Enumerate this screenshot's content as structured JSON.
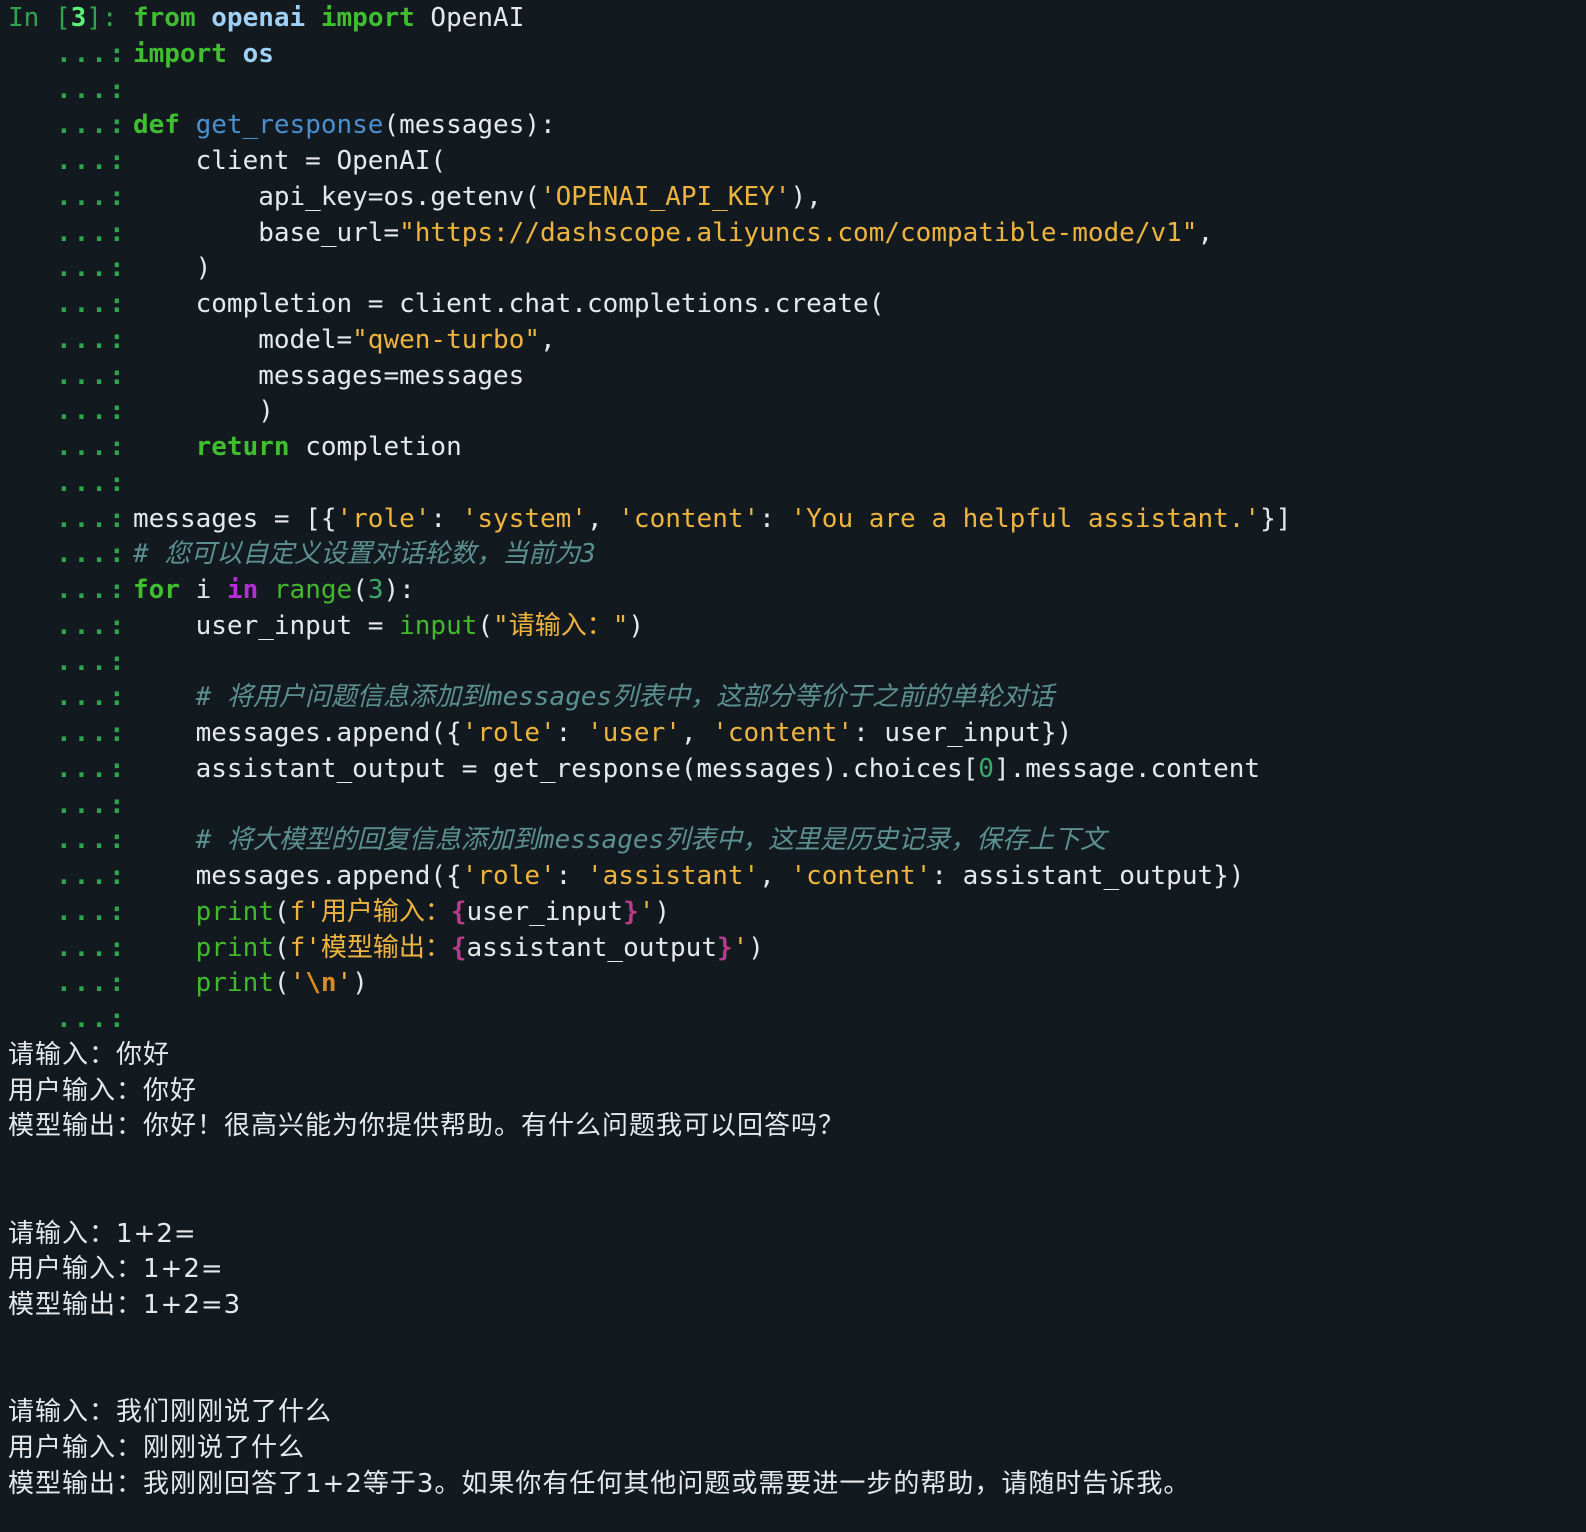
{
  "prompt": {
    "in_label": "In [",
    "cell_number": "3",
    "suffix": "]: "
  },
  "continuation_prompt": "...:",
  "code_lines": [
    [
      [
        "kw",
        "from"
      ],
      [
        "plain",
        " "
      ],
      [
        "mod",
        "openai"
      ],
      [
        "plain",
        " "
      ],
      [
        "kw",
        "import"
      ],
      [
        "plain",
        " OpenAI"
      ]
    ],
    [
      [
        "kw",
        "import"
      ],
      [
        "plain",
        " "
      ],
      [
        "mod",
        "os"
      ]
    ],
    [],
    [
      [
        "kw",
        "def"
      ],
      [
        "plain",
        " "
      ],
      [
        "fn",
        "get_response"
      ],
      [
        "plain",
        "(messages):"
      ]
    ],
    [
      [
        "plain",
        "    client = OpenAI("
      ]
    ],
    [
      [
        "plain",
        "        api_key=os.getenv("
      ],
      [
        "str",
        "'OPENAI_API_KEY'"
      ],
      [
        "plain",
        "),"
      ]
    ],
    [
      [
        "plain",
        "        base_url="
      ],
      [
        "str",
        "\"https://dashscope.aliyuncs.com/compatible-mode/v1\""
      ],
      [
        "plain",
        ","
      ]
    ],
    [
      [
        "plain",
        "    )"
      ]
    ],
    [
      [
        "plain",
        "    completion = client.chat.completions.create("
      ]
    ],
    [
      [
        "plain",
        "        model="
      ],
      [
        "str",
        "\"qwen-turbo\""
      ],
      [
        "plain",
        ","
      ]
    ],
    [
      [
        "plain",
        "        messages=messages"
      ]
    ],
    [
      [
        "plain",
        "        )"
      ]
    ],
    [
      [
        "plain",
        "    "
      ],
      [
        "kw",
        "return"
      ],
      [
        "plain",
        " completion"
      ]
    ],
    [],
    [
      [
        "plain",
        "messages = [{"
      ],
      [
        "str",
        "'role'"
      ],
      [
        "plain",
        ": "
      ],
      [
        "str",
        "'system'"
      ],
      [
        "plain",
        ", "
      ],
      [
        "str",
        "'content'"
      ],
      [
        "plain",
        ": "
      ],
      [
        "str",
        "'You are a helpful assistant.'"
      ],
      [
        "plain",
        "}]"
      ]
    ],
    [
      [
        "comment",
        "# 您可以自定义设置对话轮数，当前为3"
      ]
    ],
    [
      [
        "kw",
        "for"
      ],
      [
        "plain",
        " i "
      ],
      [
        "kw2",
        "in"
      ],
      [
        "plain",
        " "
      ],
      [
        "builtin",
        "range"
      ],
      [
        "plain",
        "("
      ],
      [
        "num",
        "3"
      ],
      [
        "plain",
        "):"
      ]
    ],
    [
      [
        "plain",
        "    user_input = "
      ],
      [
        "builtin",
        "input"
      ],
      [
        "plain",
        "("
      ],
      [
        "str",
        "\"请输入：\""
      ],
      [
        "plain",
        ")"
      ]
    ],
    [],
    [
      [
        "plain",
        "    "
      ],
      [
        "comment",
        "# 将用户问题信息添加到messages列表中，这部分等价于之前的单轮对话"
      ]
    ],
    [
      [
        "plain",
        "    messages.append({"
      ],
      [
        "str",
        "'role'"
      ],
      [
        "plain",
        ": "
      ],
      [
        "str",
        "'user'"
      ],
      [
        "plain",
        ", "
      ],
      [
        "str",
        "'content'"
      ],
      [
        "plain",
        ": user_input})"
      ]
    ],
    [
      [
        "plain",
        "    assistant_output = get_response(messages).choices["
      ],
      [
        "num",
        "0"
      ],
      [
        "plain",
        "].message.content"
      ]
    ],
    [],
    [
      [
        "plain",
        "    "
      ],
      [
        "comment",
        "# 将大模型的回复信息添加到messages列表中，这里是历史记录，保存上下文"
      ]
    ],
    [
      [
        "plain",
        "    messages.append({"
      ],
      [
        "str",
        "'role'"
      ],
      [
        "plain",
        ": "
      ],
      [
        "str",
        "'assistant'"
      ],
      [
        "plain",
        ", "
      ],
      [
        "str",
        "'content'"
      ],
      [
        "plain",
        ": assistant_output})"
      ]
    ],
    [
      [
        "plain",
        "    "
      ],
      [
        "builtin",
        "print"
      ],
      [
        "plain",
        "("
      ],
      [
        "str",
        "f'用户输入："
      ],
      [
        "interp",
        "{"
      ],
      [
        "plain",
        "user_input"
      ],
      [
        "interp",
        "}"
      ],
      [
        "str",
        "'"
      ],
      [
        "plain",
        ")"
      ]
    ],
    [
      [
        "plain",
        "    "
      ],
      [
        "builtin",
        "print"
      ],
      [
        "plain",
        "("
      ],
      [
        "str",
        "f'模型输出："
      ],
      [
        "interp",
        "{"
      ],
      [
        "plain",
        "assistant_output"
      ],
      [
        "interp",
        "}"
      ],
      [
        "str",
        "'"
      ],
      [
        "plain",
        ")"
      ]
    ],
    [
      [
        "plain",
        "    "
      ],
      [
        "builtin",
        "print"
      ],
      [
        "plain",
        "("
      ],
      [
        "str",
        "'"
      ],
      [
        "esc",
        "\\n"
      ],
      [
        "str",
        "'"
      ],
      [
        "plain",
        ")"
      ]
    ],
    []
  ],
  "output_lines": [
    "请输入：你好",
    "用户输入：你好",
    "模型输出：你好！很高兴能为你提供帮助。有什么问题我可以回答吗？",
    "",
    "",
    "请输入：1+2=",
    "用户输入：1+2=",
    "模型输出：1+2=3",
    "",
    "",
    "请输入：我们刚刚说了什么",
    "用户输入：刚刚说了什么",
    "模型输出：我刚刚回答了1+2等于3。如果你有任何其他问题或需要进一步的帮助，请随时告诉我。"
  ]
}
